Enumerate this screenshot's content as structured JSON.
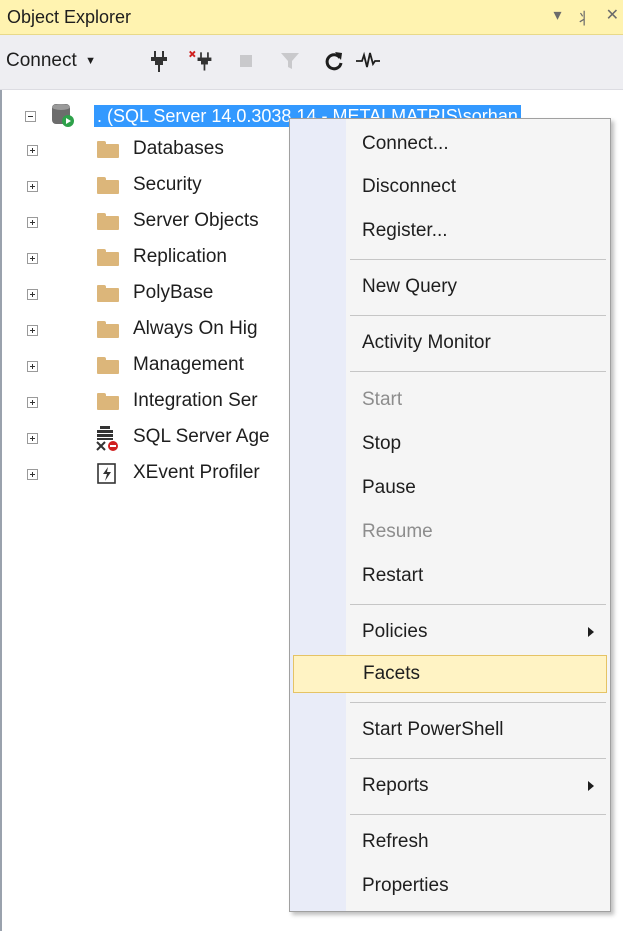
{
  "panel": {
    "title": "Object Explorer"
  },
  "titlebar_icons": [
    "dropdown-arrow-icon",
    "pin-icon",
    "close-icon"
  ],
  "toolbar": {
    "connect_label": "Connect",
    "icons": [
      "connect-plug-icon",
      "disconnect-icon",
      "stop-icon",
      "filter-icon",
      "refresh-icon",
      "activity-monitor-icon"
    ]
  },
  "tree": {
    "root_label": ". (SQL Server 14.0.3038.14 - METALMATRIS\\sorhan",
    "items": [
      {
        "label": "Databases",
        "icon": "folder-icon"
      },
      {
        "label": "Security",
        "icon": "folder-icon"
      },
      {
        "label": "Server Objects",
        "icon": "folder-icon"
      },
      {
        "label": "Replication",
        "icon": "folder-icon"
      },
      {
        "label": "PolyBase",
        "icon": "folder-icon"
      },
      {
        "label": "Always On Hig",
        "icon": "folder-icon"
      },
      {
        "label": "Management",
        "icon": "folder-icon"
      },
      {
        "label": "Integration Ser",
        "icon": "folder-icon"
      },
      {
        "label": "SQL Server Age",
        "icon": "sql-agent-icon"
      },
      {
        "label": "XEvent Profiler",
        "icon": "xevent-profiler-icon"
      }
    ]
  },
  "context_menu": {
    "items": [
      {
        "label": "Connect...",
        "enabled": true
      },
      {
        "label": "Disconnect",
        "enabled": true
      },
      {
        "label": "Register...",
        "enabled": true
      },
      {
        "label": "New Query",
        "enabled": true
      },
      {
        "label": "Activity Monitor",
        "enabled": true
      },
      {
        "label": "Start",
        "enabled": false
      },
      {
        "label": "Stop",
        "enabled": true
      },
      {
        "label": "Pause",
        "enabled": true
      },
      {
        "label": "Resume",
        "enabled": false
      },
      {
        "label": "Restart",
        "enabled": true
      },
      {
        "label": "Policies",
        "enabled": true,
        "submenu": true
      },
      {
        "label": "Facets",
        "enabled": true,
        "highlighted": true
      },
      {
        "label": "Start PowerShell",
        "enabled": true
      },
      {
        "label": "Reports",
        "enabled": true,
        "submenu": true
      },
      {
        "label": "Refresh",
        "enabled": true
      },
      {
        "label": "Properties",
        "enabled": true
      }
    ]
  },
  "colors": {
    "titlebar": "#fff3b0",
    "selection": "#3399ff",
    "menu_highlight": "#fff3c4",
    "folder": "#dcb67a"
  }
}
